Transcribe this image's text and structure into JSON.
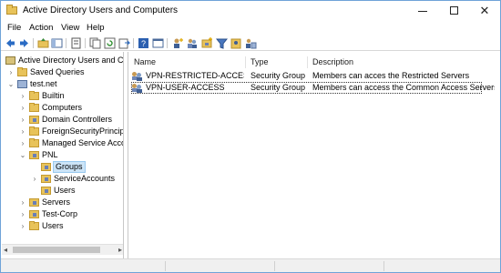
{
  "window": {
    "title": "Active Directory Users and Computers",
    "icon": "ad-folder-icon",
    "controls": {
      "minimize": "minimize-icon",
      "maximize": "maximize-icon",
      "close": "✕"
    }
  },
  "menu": {
    "file": "File",
    "action": "Action",
    "view": "View",
    "help": "Help"
  },
  "toolbar": {
    "icons": [
      "back-arrow-icon",
      "forward-arrow-icon",
      "up-folder-icon",
      "show-tree-icon",
      "properties-icon",
      "copy-icon",
      "refresh-icon",
      "export-icon",
      "help-icon",
      "console-icon",
      "new-user-icon",
      "new-group-icon",
      "new-ou-icon",
      "filter-icon",
      "add-to-group-icon",
      "delegate-icon"
    ]
  },
  "tree": {
    "root": "Active Directory Users and Com",
    "saved_queries": "Saved Queries",
    "domain": "test.net",
    "builtin": "Builtin",
    "computers": "Computers",
    "domain_controllers": "Domain Controllers",
    "foreign_security": "ForeignSecurityPrincipals",
    "managed_service": "Managed Service Accour",
    "pnl": "PNL",
    "groups": "Groups",
    "service_accounts": "ServiceAccounts",
    "pnl_users": "Users",
    "servers": "Servers",
    "test_corp": "Test-Corp",
    "users": "Users"
  },
  "list": {
    "columns": {
      "name": "Name",
      "type": "Type",
      "description": "Description"
    },
    "rows": [
      {
        "name": "VPN-RESTRICTED-ACCESS",
        "type": "Security Group...",
        "description": "Members can acces the Restricted Servers"
      },
      {
        "name": "VPN-USER-ACCESS",
        "type": "Security Group...",
        "description": "Members can access the Common Access Servers"
      }
    ]
  },
  "colors": {
    "title_border": "#6fa3d8",
    "selection": "#cce4f7",
    "folder": "#e8c35a"
  }
}
